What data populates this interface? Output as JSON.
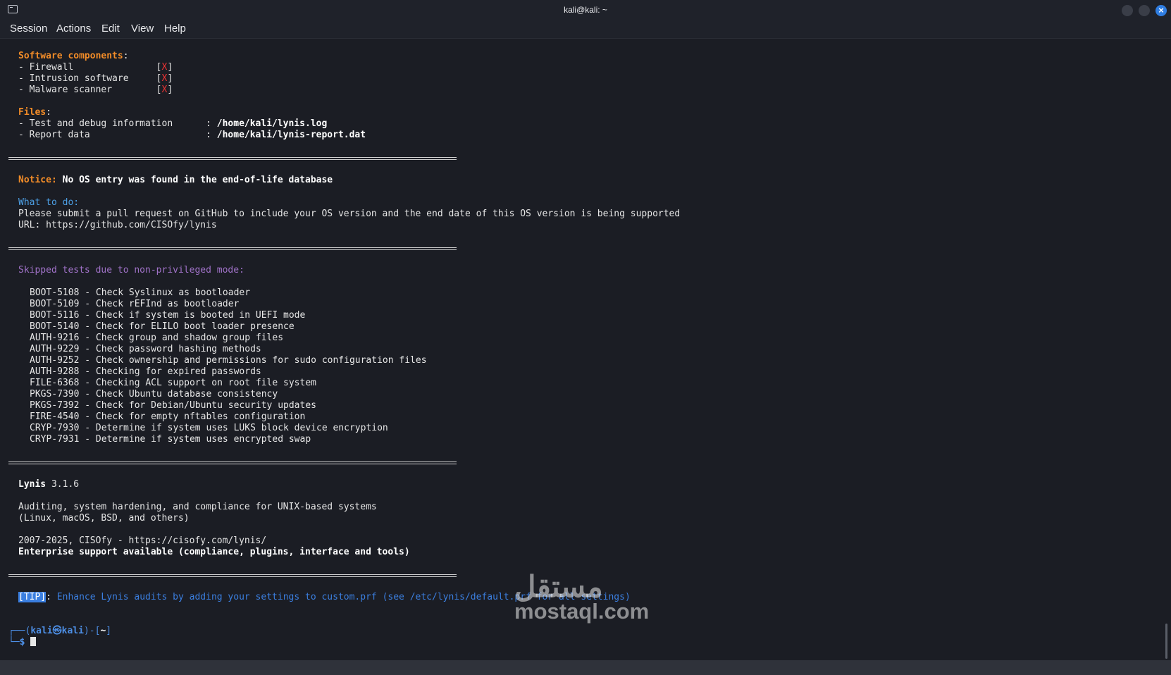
{
  "window": {
    "title": "kali@kali: ~",
    "close_glyph": "×"
  },
  "menu": [
    "Session",
    "Actions",
    "Edit",
    "View",
    "Help"
  ],
  "software": {
    "heading": "Software components",
    "items": [
      {
        "label": "- Firewall               ",
        "status": "X"
      },
      {
        "label": "- Intrusion software     ",
        "status": "X"
      },
      {
        "label": "- Malware scanner        ",
        "status": "X"
      }
    ]
  },
  "files": {
    "heading": "Files",
    "items": [
      {
        "label": "- Test and debug information      : ",
        "path": "/home/kali/lynis.log"
      },
      {
        "label": "- Report data                     : ",
        "path": "/home/kali/lynis-report.dat"
      }
    ]
  },
  "notice": {
    "label": "Notice:",
    "text": " No OS entry was found in the end-of-life database",
    "what_to_do": "What to do:",
    "line1": "Please submit a pull request on GitHub to include your OS version and the end date of this OS version is being supported",
    "line2": "URL: https://github.com/CISOfy/lynis"
  },
  "skipped": {
    "heading": "Skipped tests due to non-privileged mode:",
    "tests": [
      "BOOT-5108 - Check Syslinux as bootloader",
      "BOOT-5109 - Check rEFInd as bootloader",
      "BOOT-5116 - Check if system is booted in UEFI mode",
      "BOOT-5140 - Check for ELILO boot loader presence",
      "AUTH-9216 - Check group and shadow group files",
      "AUTH-9229 - Check password hashing methods",
      "AUTH-9252 - Check ownership and permissions for sudo configuration files",
      "AUTH-9288 - Checking for expired passwords",
      "FILE-6368 - Checking ACL support on root file system",
      "PKGS-7390 - Check Ubuntu database consistency",
      "PKGS-7392 - Check for Debian/Ubuntu security updates",
      "FIRE-4540 - Check for empty nftables configuration",
      "CRYP-7930 - Determine if system uses LUKS block device encryption",
      "CRYP-7931 - Determine if system uses encrypted swap"
    ]
  },
  "lynis": {
    "name": "Lynis",
    "version": " 3.1.6",
    "desc1": "Auditing, system hardening, and compliance for UNIX-based systems",
    "desc2": "(Linux, macOS, BSD, and others)",
    "copyright": "2007-2025, CISOfy - https://cisofy.com/lynis/",
    "enterprise": "Enterprise support available (compliance, plugins, interface and tools)"
  },
  "tip": {
    "badge": "[TIP]",
    "text": "Enhance Lynis audits by adding your settings to custom.prf (see /etc/lynis/default.prf for all settings)"
  },
  "prompt": {
    "user": "kali",
    "at": "㉿",
    "host": "kali",
    "dir": "~",
    "symbol": "$"
  },
  "watermark": {
    "arabic": "مستقل",
    "latin": "mostaql.com"
  }
}
